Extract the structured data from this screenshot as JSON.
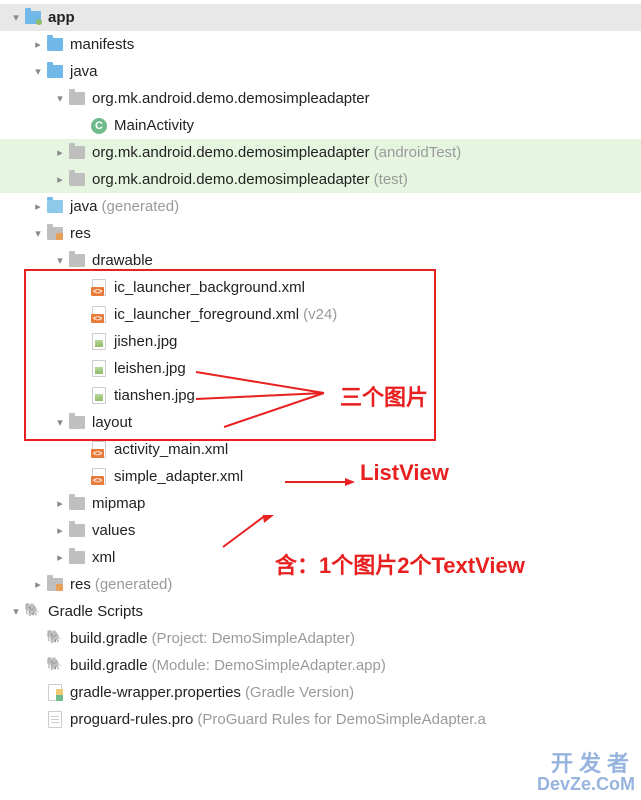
{
  "tree": {
    "app": "app",
    "manifests": "manifests",
    "java": "java",
    "pkg_main": "org.mk.android.demo.demosimpleadapter",
    "main_activity": "MainActivity",
    "pkg_test": "org.mk.android.demo.demosimpleadapter",
    "pkg_test_hint": "(androidTest)",
    "pkg_unit": "org.mk.android.demo.demosimpleadapter",
    "pkg_unit_hint": "(test)",
    "java_gen": "java",
    "java_gen_hint": "(generated)",
    "res": "res",
    "drawable": "drawable",
    "ic_bg": "ic_launcher_background.xml",
    "ic_fg": "ic_launcher_foreground.xml",
    "ic_fg_hint": "(v24)",
    "jpg1": "jishen.jpg",
    "jpg2": "leishen.jpg",
    "jpg3": "tianshen.jpg",
    "layout": "layout",
    "act_main": "activity_main.xml",
    "simple_adapter": "simple_adapter.xml",
    "mipmap": "mipmap",
    "values": "values",
    "xml": "xml",
    "res_gen": "res",
    "res_gen_hint": "(generated)",
    "gradle_scripts": "Gradle Scripts",
    "bg_proj": "build.gradle",
    "bg_proj_hint": "(Project: DemoSimpleAdapter)",
    "bg_mod": "build.gradle",
    "bg_mod_hint": "(Module: DemoSimpleAdapter.app)",
    "gw_prop": "gradle-wrapper.properties",
    "gw_prop_hint": "(Gradle Version)",
    "proguard": "proguard-rules.pro",
    "proguard_hint": "(ProGuard Rules for DemoSimpleAdapter.a"
  },
  "annotations": {
    "three_images": "三个图片",
    "listview": "ListView",
    "contains": "含：1个图片2个TextView"
  },
  "watermark": {
    "l1": "开发者",
    "l2": "DevZe.CoM"
  }
}
